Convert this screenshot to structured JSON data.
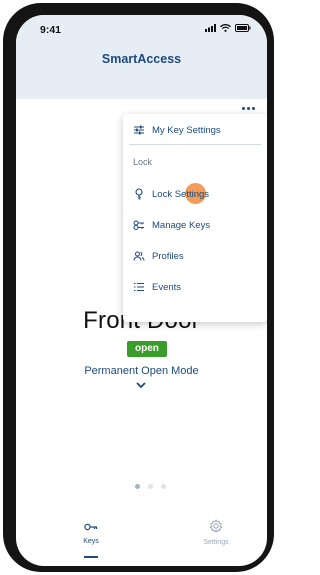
{
  "status_bar": {
    "time": "9:41"
  },
  "header": {
    "title": "SmartAccess"
  },
  "lock": {
    "name": "Front Door",
    "status": "open",
    "mode": "Permanent Open Mode"
  },
  "menu": {
    "items": [
      {
        "label": "My Key Settings",
        "icon": "sliders-icon"
      },
      {
        "label": "Lock Settings",
        "icon": "key-icon"
      },
      {
        "label": "Manage Keys",
        "icon": "keys-icon"
      },
      {
        "label": "Profiles",
        "icon": "users-icon"
      },
      {
        "label": "Events",
        "icon": "list-icon"
      }
    ],
    "section_label": "Lock"
  },
  "pager": {
    "count": 3,
    "active": 0
  },
  "tabs": [
    {
      "label": "Keys",
      "icon": "key-icon",
      "active": true
    },
    {
      "label": "Settings",
      "icon": "gear-icon",
      "active": false
    }
  ],
  "colors": {
    "primary": "#1d4a7f",
    "header_bg": "#e6edf5",
    "badge_green": "#3a9c2a",
    "tap_highlight": "#f08b3a"
  }
}
